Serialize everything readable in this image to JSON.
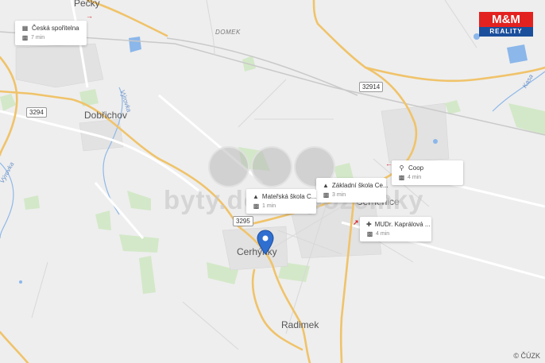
{
  "places": {
    "top_left_partial": "Pečky",
    "dobrichov": "Dobřichov",
    "domek": "DOMEK",
    "cerhynky": "Cerhýnky",
    "cerhenice": "Cerhenice",
    "radimek": "Radimek"
  },
  "road_shields": {
    "r3294": "3294",
    "r32914": "32914",
    "r3295": "3295"
  },
  "rivers": {
    "vyrovka_main": "Výrovka",
    "vyrovka_left": "Výrovka",
    "kasa": "Kasa"
  },
  "pois": [
    {
      "name": "Česká spořitelna",
      "time": "7 min",
      "icon": "bank-icon"
    },
    {
      "name": "Coop",
      "time": "4 min",
      "icon": "cart-icon"
    },
    {
      "name": "Základní škola Ce...",
      "time": "3 min",
      "icon": "school-icon"
    },
    {
      "name": "Mateřská škola C...",
      "time": "1 min",
      "icon": "school-icon"
    },
    {
      "name": "MUDr. Kaprálová ...",
      "time": "4 min",
      "icon": "medical-icon"
    }
  ],
  "marker_icon": "location-pin-icon",
  "car_icon": "car-icon",
  "watermark": "byty.domy.pozemky",
  "logo": {
    "top": "M&M",
    "bottom": "REALITY"
  },
  "copyright": "© ČÚZK",
  "colors": {
    "background": "#eeeeee",
    "roads_major": "#f2c46d",
    "water": "#6da7e6",
    "greenery": "#cfe6c2",
    "marker": "#2f6fd0"
  }
}
